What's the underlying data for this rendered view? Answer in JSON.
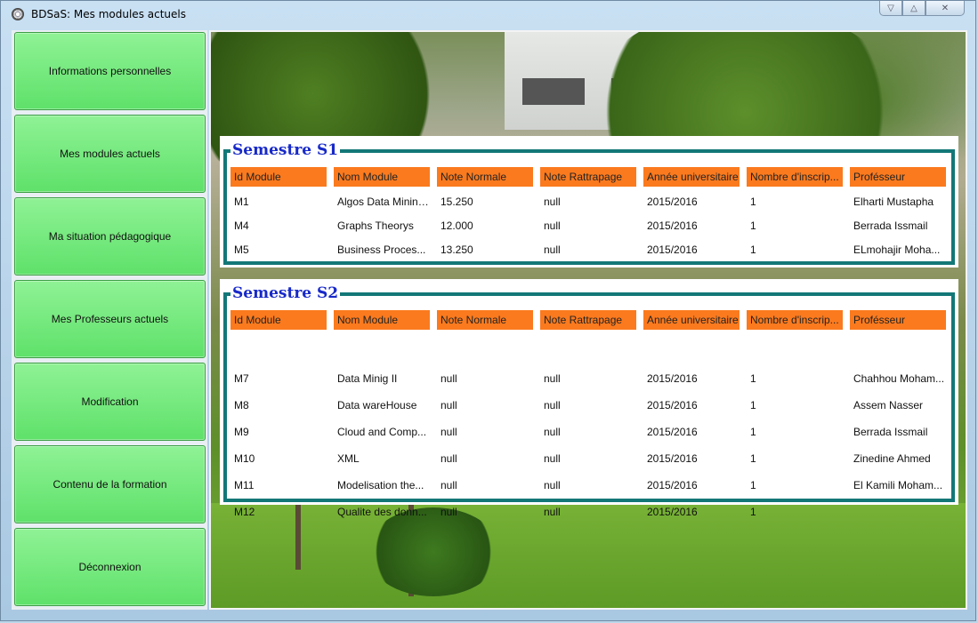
{
  "window": {
    "title": "BDSaS: Mes modules actuels",
    "controls": [
      "▽",
      "△",
      "✕"
    ]
  },
  "sidebar": {
    "items": [
      {
        "label": "Informations personnelles"
      },
      {
        "label": "Mes modules actuels"
      },
      {
        "label": "Ma situation pédagogique"
      },
      {
        "label": "Mes Professeurs actuels"
      },
      {
        "label": "Modification"
      },
      {
        "label": "Contenu de la formation"
      },
      {
        "label": "Déconnexion"
      }
    ]
  },
  "colors": {
    "nav_button": "#6ae574",
    "table_header": "#fb7a1e",
    "group_border": "#137777",
    "group_title": "#1729c8"
  },
  "columns": [
    "Id Module",
    "Nom Module",
    "Note Normale",
    "Note Rattrapage",
    "Année universitaire",
    "Nombre d'inscrip...",
    "Profésseur"
  ],
  "semestre_s1": {
    "title": "Semestre S1",
    "rows": [
      [
        "M1",
        "Algos Data Mining I",
        "15.250",
        "null",
        "2015/2016",
        "1",
        "Elharti Mustapha"
      ],
      [
        "M4",
        "Graphs Theorys",
        "12.000",
        "null",
        "2015/2016",
        "1",
        "Berrada Issmail"
      ],
      [
        "M5",
        "Business Proces...",
        "13.250",
        "null",
        "2015/2016",
        "1",
        "ELmohajir Moha..."
      ]
    ]
  },
  "semestre_s2": {
    "title": "Semestre S2",
    "rows": [
      [
        "M7",
        "Data Minig II",
        "null",
        "null",
        "2015/2016",
        "1",
        "Chahhou Moham..."
      ],
      [
        "M8",
        "Data wareHouse",
        "null",
        "null",
        "2015/2016",
        "1",
        "Assem Nasser"
      ],
      [
        "M9",
        "Cloud and Comp...",
        "null",
        "null",
        "2015/2016",
        "1",
        "Berrada Issmail"
      ],
      [
        "M10",
        "XML",
        "null",
        "null",
        "2015/2016",
        "1",
        "Zinedine Ahmed"
      ],
      [
        "M11",
        "Modelisation the...",
        "null",
        "null",
        "2015/2016",
        "1",
        "El Kamili Moham..."
      ],
      [
        "M12",
        "Qualite des donn...",
        "null",
        "null",
        "2015/2016",
        "1",
        ""
      ]
    ]
  }
}
